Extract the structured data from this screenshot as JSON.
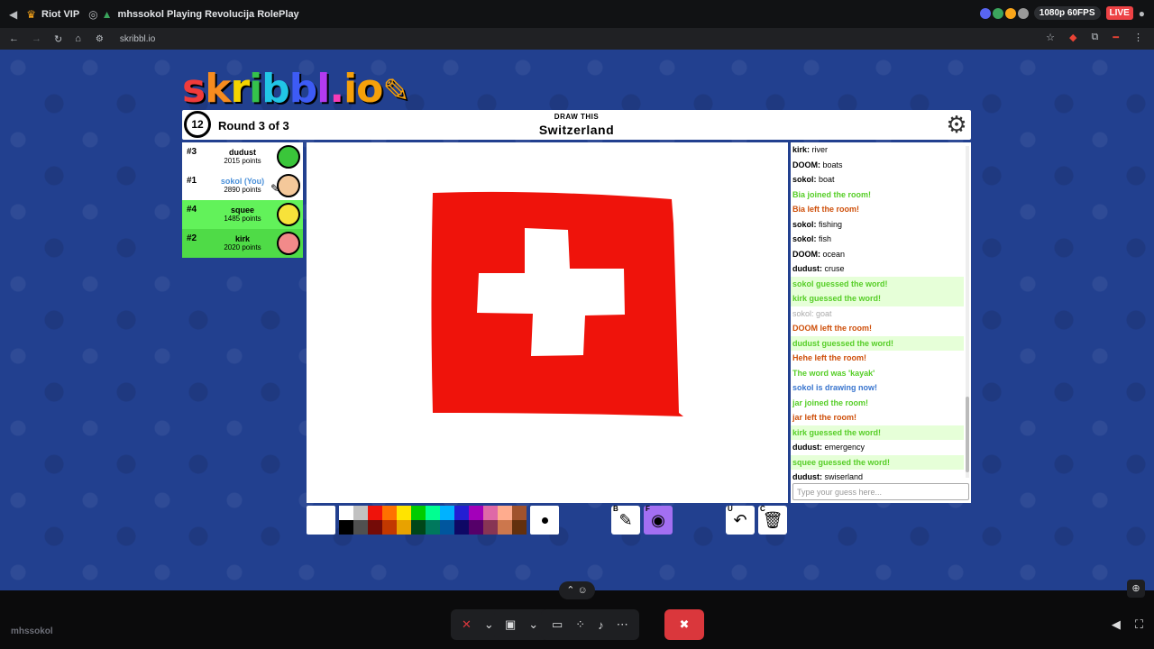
{
  "stream": {
    "vip_label": "Riot VIP",
    "title": "mhssokol Playing Revolucija RolePlay",
    "quality": "1080p 60FPS",
    "live": "LIVE"
  },
  "browser": {
    "url": "skribbl.io"
  },
  "game": {
    "logo": [
      "s",
      "k",
      "r",
      "i",
      "b",
      "b",
      "l",
      ".",
      "io"
    ],
    "timer": "12",
    "round": "Round 3 of 3",
    "draw_this": "DRAW THIS",
    "word": "Switzerland"
  },
  "players": [
    {
      "rank": "#3",
      "name": "dudust",
      "points": "2015 points",
      "bg": "#ffffff",
      "avatar_color": "#3ac63a"
    },
    {
      "rank": "#1",
      "name": "sokol (You)",
      "points": "2890 points",
      "bg": "#ffffff",
      "avatar_color": "#f4c89a",
      "you": true,
      "drawing": true
    },
    {
      "rank": "#4",
      "name": "squee",
      "points": "1485 points",
      "bg": "#62f25a",
      "avatar_color": "#f7e23a"
    },
    {
      "rank": "#2",
      "name": "kirk",
      "points": "2020 points",
      "bg": "#4fdb47",
      "avatar_color": "#f28a8a"
    }
  ],
  "chat": {
    "messages": [
      {
        "type": "normal",
        "user": "kirk",
        "text": "river"
      },
      {
        "type": "normal",
        "user": "DOOM",
        "text": "boats"
      },
      {
        "type": "normal",
        "user": "sokol",
        "text": "boat"
      },
      {
        "type": "green",
        "text": "Bia joined the room!"
      },
      {
        "type": "red",
        "text": "Bia left the room!"
      },
      {
        "type": "normal",
        "user": "sokol",
        "text": "fishing"
      },
      {
        "type": "normal",
        "user": "sokol",
        "text": "fish"
      },
      {
        "type": "normal",
        "user": "DOOM",
        "text": "ocean"
      },
      {
        "type": "normal",
        "user": "dudust",
        "text": "cruse"
      },
      {
        "type": "greenbg",
        "text": "sokol guessed the word!"
      },
      {
        "type": "greenbg",
        "text": "kirk guessed the word!"
      },
      {
        "type": "faded",
        "text": "sokol: goat"
      },
      {
        "type": "red",
        "text": "DOOM left the room!"
      },
      {
        "type": "greenbg",
        "text": "dudust guessed the word!"
      },
      {
        "type": "red",
        "text": "Hehe left the room!"
      },
      {
        "type": "green",
        "text": "The word was 'kayak'"
      },
      {
        "type": "blue",
        "text": "sokol is drawing now!"
      },
      {
        "type": "green",
        "text": "jar joined the room!"
      },
      {
        "type": "red",
        "text": "jar left the room!"
      },
      {
        "type": "greenbg",
        "text": "kirk guessed the word!"
      },
      {
        "type": "normal",
        "user": "dudust",
        "text": "emergency"
      },
      {
        "type": "greenbg",
        "text": "squee guessed the word!"
      },
      {
        "type": "normal",
        "user": "dudust",
        "text": "swiserland"
      }
    ],
    "input_placeholder": "Type your guess here..."
  },
  "toolbar": {
    "current_color": "#ffffff",
    "palette": [
      "#ffffff",
      "#c1c1c1",
      "#ef130b",
      "#ff7100",
      "#ffe400",
      "#00cc00",
      "#00ff91",
      "#00b2ff",
      "#231fd3",
      "#a300ba",
      "#df69a7",
      "#ffac8e",
      "#a0522d",
      "#000000",
      "#505050",
      "#740b07",
      "#c23800",
      "#e8a200",
      "#004619",
      "#00785d",
      "#00569e",
      "#0e0865",
      "#550069",
      "#873554",
      "#cc774d",
      "#63300d"
    ],
    "tools": [
      {
        "key": "B",
        "name": "brush-tool",
        "icon": "✎",
        "active": false
      },
      {
        "key": "F",
        "name": "fill-tool",
        "icon": "◉",
        "active": true
      },
      {
        "key": "U",
        "name": "undo-tool",
        "icon": "↶",
        "active": false
      },
      {
        "key": "C",
        "name": "clear-tool",
        "icon": "🗑",
        "active": false
      }
    ]
  },
  "bottom": {
    "username": "mhssokol"
  }
}
